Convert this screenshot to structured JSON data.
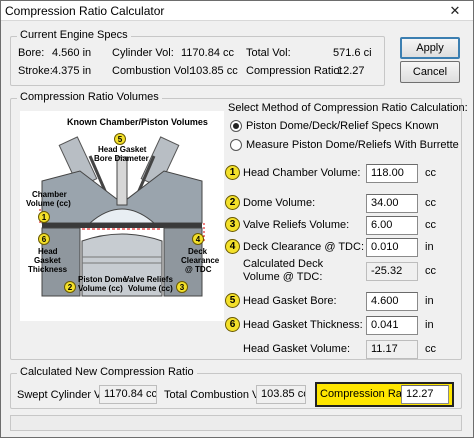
{
  "window": {
    "title": "Compression Ratio Calculator",
    "close_glyph": "✕"
  },
  "specs": {
    "title": "Current Engine Specs",
    "bore_label": "Bore:",
    "bore_value": "4.560 in",
    "stroke_label": "Stroke:",
    "stroke_value": "4.375 in",
    "cyl_vol_label": "Cylinder Vol:",
    "cyl_vol_value": "1170.84 cc",
    "comb_vol_label": "Combustion Vol:",
    "comb_vol_value": "103.85 cc",
    "total_vol_label": "Total Vol:",
    "total_vol_value": "571.6 ci",
    "cr_label": "Compression Ratio:",
    "cr_value": "12.27"
  },
  "buttons": {
    "apply": "Apply",
    "cancel": "Cancel"
  },
  "volumes": {
    "title": "Compression Ratio Volumes",
    "method_label": "Select Method of Compression Ratio Calculation:",
    "radio1": "Piston Dome/Deck/Relief Specs Known",
    "radio2": "Measure Piston Dome/Reliefs With Burrette",
    "rows": {
      "head_chamber": {
        "num": "1",
        "label": "Head Chamber Volume:",
        "value": "118.00",
        "unit": "cc"
      },
      "dome": {
        "num": "2",
        "label": "Dome Volume:",
        "value": "34.00",
        "unit": "cc"
      },
      "reliefs": {
        "num": "3",
        "label": "Valve Reliefs Volume:",
        "value": "6.00",
        "unit": "cc"
      },
      "deck": {
        "num": "4",
        "label": "Deck Clearance @ TDC:",
        "value": "0.010",
        "unit": "in"
      },
      "calc_deck": {
        "label1": "Calculated Deck",
        "label2": "Volume @ TDC:",
        "value": "-25.32",
        "unit": "cc"
      },
      "gasket_bore": {
        "num": "5",
        "label": "Head Gasket Bore:",
        "value": "4.600",
        "unit": "in"
      },
      "gasket_thick": {
        "num": "6",
        "label": "Head Gasket Thickness:",
        "value": "0.041",
        "unit": "in"
      },
      "gasket_vol": {
        "label": "Head Gasket Volume:",
        "value": "11.17",
        "unit": "cc"
      }
    }
  },
  "diagram": {
    "title": "Known Chamber/Piston Volumes",
    "n1": "1",
    "n2": "2",
    "n3": "3",
    "n4": "4",
    "n5": "5",
    "n6": "6",
    "gasket_bore_1": "Head Gasket",
    "gasket_bore_2": "Bore Diameter",
    "chamber_1": "Chamber",
    "chamber_2": "Volume (cc)",
    "gasket_thick_1": "Head",
    "gasket_thick_2": "Gasket",
    "gasket_thick_3": "Thickness",
    "deck_1": "Deck",
    "deck_2": "Clearance",
    "deck_3": "@ TDC",
    "dome_1": "Piston Dome",
    "dome_2": "Volume (cc)",
    "relief_1": "Valve Reliefs",
    "relief_2": "Volume (cc)"
  },
  "result": {
    "title": "Calculated New Compression Ratio",
    "swept_label": "Swept Cylinder Vol:",
    "swept_value": "1170.84 cc",
    "total_comb_label": "Total Combustion Vol:",
    "total_comb_value": "103.85 cc",
    "cr_label": "Compression Ratio:",
    "cr_value": "12.27"
  },
  "colors": {
    "badge": "#f3e02a",
    "highlight": "#ffe600",
    "head": "#9aa4ad",
    "piston": "#c7ccd1"
  }
}
